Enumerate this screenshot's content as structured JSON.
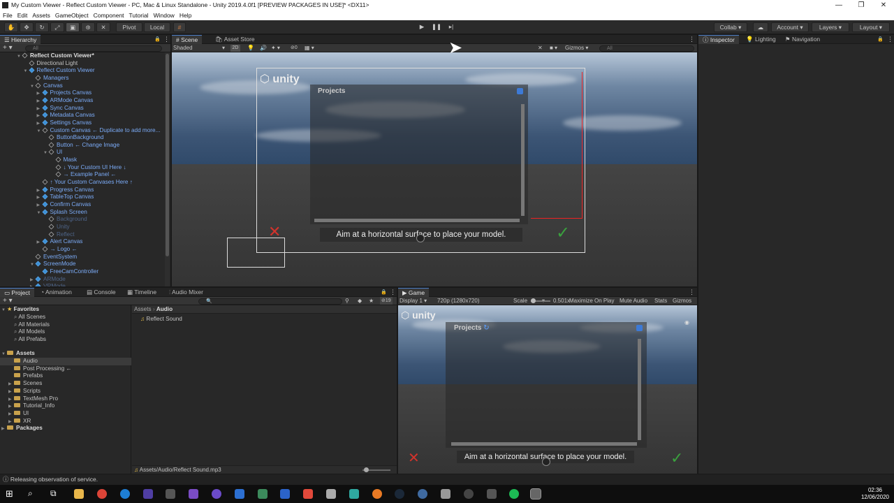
{
  "titlebar": {
    "title": "My Custom Viewer - Reflect Custom Viewer - PC, Mac & Linux Standalone - Unity 2019.4.0f1 [PREVIEW PACKAGES IN USE]* <DX11>"
  },
  "menu": [
    "File",
    "Edit",
    "Assets",
    "GameObject",
    "Component",
    "Tutorial",
    "Window",
    "Help"
  ],
  "toolbar": {
    "pivot": "Pivot",
    "local": "Local",
    "collab": "Collab",
    "account": "Account",
    "layers": "Layers",
    "layout": "Layout"
  },
  "hierarchy": {
    "tab": "Hierarchy",
    "search": "All",
    "rows": [
      {
        "t": "Reflect Custom Viewer*",
        "i": 0,
        "c": "white",
        "ic": "scene",
        "open": true
      },
      {
        "t": "Directional Light",
        "i": 1,
        "c": "white",
        "ic": "go"
      },
      {
        "t": "Reflect Custom Viewer",
        "i": 1,
        "c": "blue",
        "ic": "blue",
        "open": true
      },
      {
        "t": "Managers",
        "i": 2,
        "c": "blue",
        "ic": "go"
      },
      {
        "t": "Canvas",
        "i": 2,
        "c": "blue",
        "ic": "go",
        "open": true
      },
      {
        "t": "Projects Canvas",
        "i": 3,
        "c": "blue",
        "ic": "blue",
        "closed": true
      },
      {
        "t": "ARMode Canvas",
        "i": 3,
        "c": "blue",
        "ic": "blue",
        "closed": true
      },
      {
        "t": "Sync Canvas",
        "i": 3,
        "c": "blue",
        "ic": "blue",
        "closed": true
      },
      {
        "t": "Metadata Canvas",
        "i": 3,
        "c": "blue",
        "ic": "blue",
        "closed": true
      },
      {
        "t": "Settings Canvas",
        "i": 3,
        "c": "blue",
        "ic": "blue",
        "closed": true
      },
      {
        "t": "Custom Canvas ← Duplicate to add more...",
        "i": 3,
        "c": "blue",
        "ic": "go",
        "open": true
      },
      {
        "t": "ButtonBackground",
        "i": 4,
        "c": "blue",
        "ic": "go"
      },
      {
        "t": "Button ← Change Image",
        "i": 4,
        "c": "blue",
        "ic": "go"
      },
      {
        "t": "UI",
        "i": 4,
        "c": "blue",
        "ic": "go",
        "open": true
      },
      {
        "t": "Mask",
        "i": 5,
        "c": "blue",
        "ic": "go"
      },
      {
        "t": "↓ Your Custom UI Here ↓",
        "i": 5,
        "c": "blue",
        "ic": "go"
      },
      {
        "t": "→ Example Panel ←",
        "i": 5,
        "c": "blue",
        "ic": "go"
      },
      {
        "t": "↑ Your Custom Canvases Here ↑",
        "i": 3,
        "c": "blue",
        "ic": "go"
      },
      {
        "t": "Progress Canvas",
        "i": 3,
        "c": "blue",
        "ic": "blue",
        "closed": true
      },
      {
        "t": "TableTop Canvas",
        "i": 3,
        "c": "blue",
        "ic": "blue",
        "closed": true
      },
      {
        "t": "Confirm Canvas",
        "i": 3,
        "c": "blue",
        "ic": "blue",
        "closed": true
      },
      {
        "t": "Splash Screen",
        "i": 3,
        "c": "blue",
        "ic": "blue",
        "open": true
      },
      {
        "t": "Background",
        "i": 4,
        "c": "dim",
        "ic": "go"
      },
      {
        "t": "Unity",
        "i": 4,
        "c": "dim",
        "ic": "go"
      },
      {
        "t": "Reflect",
        "i": 4,
        "c": "dim",
        "ic": "go"
      },
      {
        "t": "Alert Canvas",
        "i": 3,
        "c": "blue",
        "ic": "blue",
        "closed": true
      },
      {
        "t": "→ Logo ←",
        "i": 3,
        "c": "blue",
        "ic": "go"
      },
      {
        "t": "EventSystem",
        "i": 2,
        "c": "blue",
        "ic": "go"
      },
      {
        "t": "ScreenMode",
        "i": 2,
        "c": "blue",
        "ic": "blue",
        "open": true
      },
      {
        "t": "FreeCamController",
        "i": 3,
        "c": "blue",
        "ic": "blue"
      },
      {
        "t": "ARMode",
        "i": 2,
        "c": "dim",
        "ic": "blue",
        "closed": true
      },
      {
        "t": "VRMode",
        "i": 2,
        "c": "dim",
        "ic": "blue",
        "closed": true
      }
    ]
  },
  "scene": {
    "tabs": [
      "Scene",
      "Asset Store"
    ],
    "shading": "Shaded",
    "mode2d": "2D",
    "gizmos": "Gizmos",
    "search": "All",
    "projects": "Projects",
    "unity": "unity",
    "prompt": "Aim at a horizontal surface to place your model."
  },
  "inspector": {
    "tabs": [
      "Inspector",
      "Lighting",
      "Navigation"
    ]
  },
  "project": {
    "tabs": [
      "Project",
      "Animation",
      "Console",
      "Timeline",
      "Audio Mixer"
    ],
    "favorites": {
      "label": "Favorites",
      "items": [
        "All Scenes",
        "All Materials",
        "All Models",
        "All Prefabs"
      ]
    },
    "assets": {
      "label": "Assets",
      "items": [
        "Audio",
        "Post Processing ←",
        "Prefabs",
        "Scenes",
        "Scripts",
        "TextMesh Pro",
        "Tutorial_Info",
        "UI",
        "XR"
      ]
    },
    "packages": "Packages",
    "breadcrumb": [
      "Assets",
      "Audio"
    ],
    "files": [
      "Reflect Sound"
    ],
    "path": "Assets/Audio/Reflect Sound.mp3",
    "count": "19"
  },
  "game": {
    "tab": "Game",
    "display": "Display 1",
    "resolution": "720p (1280x720)",
    "scale_label": "Scale",
    "scale_value": "0.501x",
    "max_on_play": "Maximize On Play",
    "mute": "Mute Audio",
    "stats": "Stats",
    "gizmos": "Gizmos",
    "projects": "Projects",
    "unity": "unity",
    "prompt": "Aim at a horizontal surface to place your model."
  },
  "status": {
    "text": "Releasing observation of service."
  },
  "clock": {
    "time": "02:36",
    "date": "12/06/2020"
  },
  "colors": {
    "accent": "#4c7ec8",
    "blue_text": "#7cacf8",
    "cancel_red": "#d2332c",
    "confirm_green": "#3aa13e"
  }
}
